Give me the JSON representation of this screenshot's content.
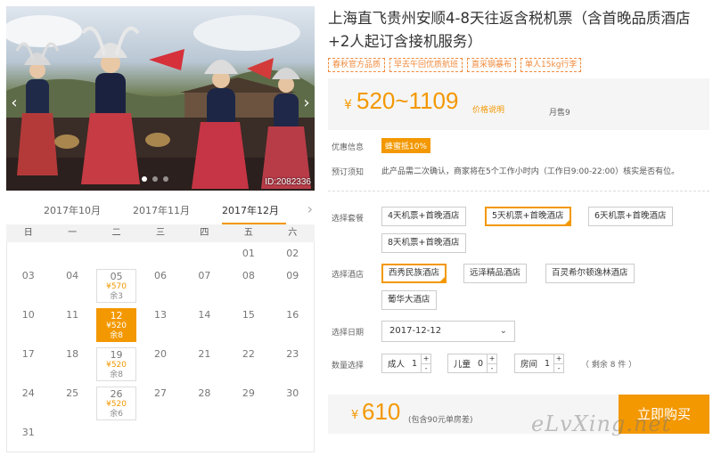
{
  "photo": {
    "id_label": "ID:2082336",
    "prev_icon": "‹",
    "next_icon": "›"
  },
  "calendar": {
    "months": [
      "2017年10月",
      "2017年11月",
      "2017年12月"
    ],
    "active_month": "2017年12月",
    "next_icon": "›",
    "weekdays": [
      "日",
      "一",
      "二",
      "三",
      "四",
      "五",
      "六"
    ],
    "cells": [
      {
        "d": ""
      },
      {
        "d": ""
      },
      {
        "d": ""
      },
      {
        "d": ""
      },
      {
        "d": ""
      },
      {
        "d": "01"
      },
      {
        "d": "02"
      },
      {
        "d": "03"
      },
      {
        "d": "04"
      },
      {
        "d": "05",
        "price": "¥570",
        "stock": "余3"
      },
      {
        "d": "06"
      },
      {
        "d": "07"
      },
      {
        "d": "08"
      },
      {
        "d": "09"
      },
      {
        "d": "10"
      },
      {
        "d": "11"
      },
      {
        "d": "12",
        "price": "¥520",
        "stock": "余8",
        "selected": true
      },
      {
        "d": "13"
      },
      {
        "d": "14"
      },
      {
        "d": "15"
      },
      {
        "d": "16"
      },
      {
        "d": "17"
      },
      {
        "d": "18"
      },
      {
        "d": "19",
        "price": "¥520",
        "stock": "余8"
      },
      {
        "d": "20"
      },
      {
        "d": "21"
      },
      {
        "d": "22"
      },
      {
        "d": "23"
      },
      {
        "d": "24"
      },
      {
        "d": "25"
      },
      {
        "d": "26",
        "price": "¥520",
        "stock": "余6"
      },
      {
        "d": "27"
      },
      {
        "d": "28"
      },
      {
        "d": "29"
      },
      {
        "d": "30"
      },
      {
        "d": "31"
      },
      {
        "d": ""
      },
      {
        "d": ""
      },
      {
        "d": ""
      },
      {
        "d": ""
      },
      {
        "d": ""
      },
      {
        "d": ""
      }
    ]
  },
  "product": {
    "title": "上海直飞贵州安顺4-8天往返含税机票（含首晚品质酒店+2人起订含接机服务）",
    "tags": [
      "春秋官方品质",
      "早去午回优质航班",
      "直采钢暴布",
      "单人15kg行李"
    ],
    "price_currency": "¥",
    "price_range": "520~1109",
    "price_note": "价格说明",
    "monthly_sales": "月售9"
  },
  "info": {
    "promo_label": "优惠信息",
    "promo_badge": "蜂蜜抵10%",
    "notice_label": "预订须知",
    "notice_text": "此产品需二次确认，商家将在5个工作小时内（工作日9:00-22:00）核实是否有位。"
  },
  "packages": {
    "label": "选择套餐",
    "options": [
      "4天机票+首晚酒店",
      "5天机票+首晚酒店",
      "6天机票+首晚酒店",
      "8天机票+首晚酒店"
    ],
    "selected": "5天机票+首晚酒店"
  },
  "hotels": {
    "label": "选择酒店",
    "options": [
      "西秀民族酒店",
      "远泽精品酒店",
      "百灵希尔顿逸林酒店",
      "葡华大酒店"
    ],
    "selected": "西秀民族酒店"
  },
  "date": {
    "label": "选择日期",
    "value": "2017-12-12",
    "chevron": "⌄"
  },
  "quantity": {
    "label": "数量选择",
    "adult": {
      "label": "成人",
      "value": "1"
    },
    "child": {
      "label": "儿童",
      "value": "0"
    },
    "room": {
      "label": "房间",
      "value": "1"
    },
    "remaining": "（ 剩余 8 件 ）",
    "plus": "+",
    "minus": "-"
  },
  "footer": {
    "currency": "¥",
    "total": "610",
    "included": "(包含90元单房差)",
    "buy_label": "立即购买",
    "watermark": "eLvXing.net"
  },
  "colors": {
    "accent": "#f39800"
  }
}
